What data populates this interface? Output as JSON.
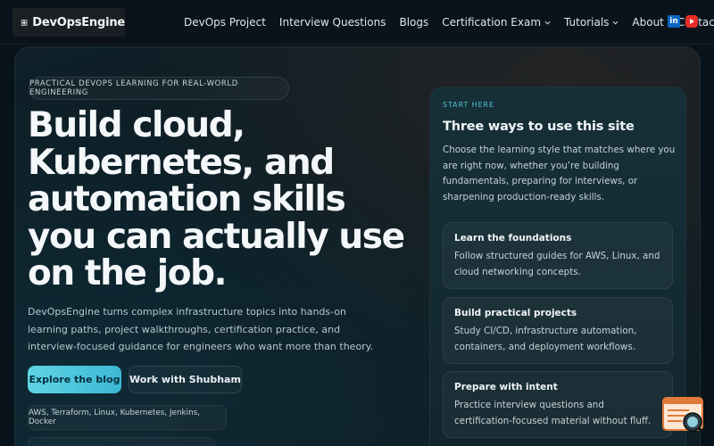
{
  "brand": {
    "name": "DevOpsEngine"
  },
  "nav": {
    "items": [
      {
        "label": "DevOps Project"
      },
      {
        "label": "Interview Questions"
      },
      {
        "label": "Blogs"
      },
      {
        "label": "Certification Exam"
      },
      {
        "label": "Tutorials"
      },
      {
        "label": "About"
      },
      {
        "label": "Contact"
      }
    ],
    "social": {
      "linkedin": "in"
    }
  },
  "hero": {
    "eyebrow": "PRACTICAL DEVOPS LEARNING FOR REAL-WORLD ENGINEERING",
    "headline": "Build cloud, Kubernetes, and automation skills you can actually use on the job.",
    "lead": "DevOpsEngine turns complex infrastructure topics into hands-on learning paths, project walkthroughs, certification practice, and interview-focused guidance for engineers who want more than theory.",
    "primary_cta": "Explore the blog",
    "secondary_cta": "Work with Shubham",
    "tags": "AWS, Terraform, Linux, Kubernetes, Jenkins, Docker"
  },
  "panel": {
    "eyebrow": "START HERE",
    "title": "Three ways to use this site",
    "description": "Choose the learning style that matches where you are right now, whether you’re building fundamentals, preparing for interviews, or sharpening production-ready skills.",
    "cards": [
      {
        "title": "Learn the foundations",
        "body": "Follow structured guides for AWS, Linux, and cloud networking concepts."
      },
      {
        "title": "Build practical projects",
        "body": "Study CI/CD, infrastructure automation, containers, and deployment workflows."
      },
      {
        "title": "Prepare with intent",
        "body": "Practice interview questions and certification-focused material without fluff."
      }
    ]
  },
  "colors": {
    "accent": "#4fc0cf",
    "primary_button": "#5fd4e3",
    "background": "#07121a",
    "linkedin": "#0a66c2",
    "youtube": "#e52d27"
  },
  "icons": {
    "logo": "flower-logo-icon",
    "caret": "chevron-down-icon",
    "linkedin": "linkedin-icon",
    "youtube": "youtube-icon",
    "widget": "reading-assistant-icon"
  }
}
